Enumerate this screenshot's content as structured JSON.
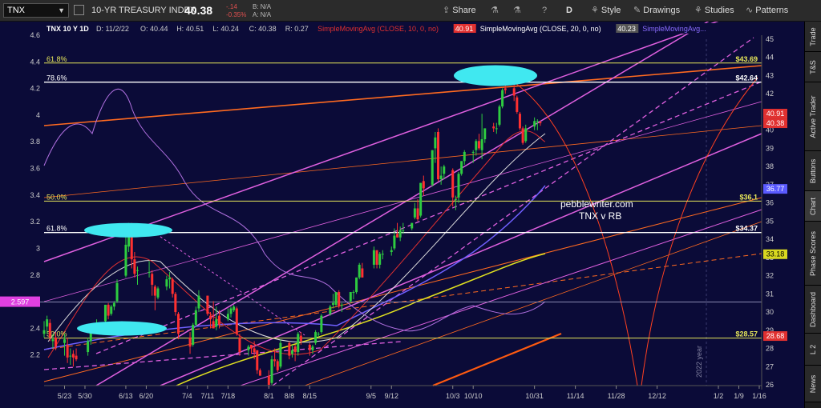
{
  "toolbar": {
    "symbol": "TNX",
    "description": "10-YR TREASURY INDEX",
    "last": "40.38",
    "change": "-.14",
    "change_pct": "-0.35%",
    "bid": "B: N/A",
    "ask": "A: N/A",
    "share": "Share",
    "period": "D",
    "style": "Style",
    "drawings": "Drawings",
    "studies": "Studies",
    "patterns": "Patterns"
  },
  "right_tabs": [
    "Trade",
    "T&S",
    "Active Trader",
    "Buttons",
    "Chart",
    "Phase Scores",
    "Dashboard",
    "L 2",
    "News"
  ],
  "chart_data": {
    "type": "line",
    "title": "TNX 10 Y 1D",
    "ohlc_header": {
      "date": "D: 11/2/22",
      "open": "O: 40.44",
      "high": "H: 40.51",
      "low": "L: 40.24",
      "close": "C: 40.38",
      "range": "R: 0.27"
    },
    "study_legend": [
      {
        "label": "SimpleMovingAvg (CLOSE, 10, 0, no)",
        "value": "40.91",
        "color": "#e03030"
      },
      {
        "label": "SimpleMovingAvg (CLOSE, 20, 0, no)",
        "value": "40.23",
        "color": "#ffffff"
      },
      {
        "label": "SimpleMovingAvg...",
        "value": "",
        "color": "#8a6cff"
      }
    ],
    "x_ticks": [
      "5/23",
      "5/30",
      "6/13",
      "6/20",
      "7/4",
      "7/11",
      "7/18",
      "8/1",
      "8/8",
      "8/15",
      "9/5",
      "9/12",
      "10/3",
      "10/10",
      "10/31",
      "11/14",
      "11/28",
      "12/12",
      "1/2",
      "1/9",
      "1/16"
    ],
    "x_tick_dates": [
      "2022-05-23",
      "2022-05-30",
      "2022-06-13",
      "2022-06-20",
      "2022-07-04",
      "2022-07-11",
      "2022-07-18",
      "2022-08-01",
      "2022-08-08",
      "2022-08-15",
      "2022-09-05",
      "2022-09-12",
      "2022-10-03",
      "2022-10-10",
      "2022-10-31",
      "2022-11-14",
      "2022-11-28",
      "2022-12-12",
      "2023-01-02",
      "2023-01-09",
      "2023-01-16"
    ],
    "xlim": [
      "2022-05-16",
      "2023-01-16"
    ],
    "year_marker": {
      "label": "2022 year",
      "date": "2023-01-02"
    },
    "left_axis": {
      "ylim": [
        2.0,
        4.6
      ],
      "ticks": [
        2.2,
        2.4,
        2.6,
        2.8,
        3,
        3.2,
        3.4,
        3.6,
        3.8,
        4,
        4.2,
        4.4,
        4.6
      ],
      "marker": {
        "label": "2.597",
        "value": 2.597,
        "color": "#e040e0"
      }
    },
    "right_axis": {
      "ylim": [
        26,
        45
      ],
      "ticks": [
        26,
        27,
        28,
        29,
        30,
        31,
        32,
        33,
        34,
        35,
        36,
        37,
        38,
        39,
        40,
        41,
        42,
        43,
        44,
        45
      ]
    },
    "fib_levels": [
      {
        "label": "61.8%",
        "value": 43.69,
        "price": "$43.69",
        "color": "#e8e85a"
      },
      {
        "label": "78.6%",
        "value": 42.64,
        "price": "$42.64",
        "color": "#ffffff"
      },
      {
        "label": "50.0%",
        "value": 36.1,
        "price": "$36.1",
        "color": "#e8e85a"
      },
      {
        "label": "61.8%",
        "value": 34.37,
        "price": "$34.37",
        "color": "#ffffff"
      },
      {
        "label": "50.0%",
        "value": 28.57,
        "price": "$28.57",
        "color": "#e8e85a"
      }
    ],
    "price_badges": [
      {
        "value": 40.91,
        "label": "40.91",
        "color": "#e03030"
      },
      {
        "value": 40.38,
        "label": "40.38",
        "color": "#e03030"
      },
      {
        "value": 36.77,
        "label": "36.77",
        "color": "#5a5aff"
      },
      {
        "value": 33.18,
        "label": "33.18",
        "color": "#d8d820"
      },
      {
        "value": 28.68,
        "label": "28.68",
        "color": "#e03030"
      }
    ],
    "annotations": [
      "pebblewriter.com",
      "TNX v RB"
    ],
    "candles": [
      [
        "2022-05-16",
        28.8,
        29.5,
        28.6,
        29.0
      ],
      [
        "2022-05-17",
        29.2,
        29.8,
        28.8,
        29.6
      ],
      [
        "2022-05-18",
        29.4,
        29.6,
        28.4,
        28.6
      ],
      [
        "2022-05-19",
        28.4,
        28.8,
        28.0,
        28.5
      ],
      [
        "2022-05-20",
        28.6,
        28.9,
        27.9,
        28.1
      ],
      [
        "2022-05-23",
        28.3,
        28.8,
        27.6,
        28.5
      ],
      [
        "2022-05-24",
        28.2,
        28.6,
        27.2,
        27.5
      ],
      [
        "2022-05-25",
        27.6,
        28.0,
        27.1,
        27.6
      ],
      [
        "2022-05-26",
        27.7,
        27.9,
        27.0,
        27.5
      ],
      [
        "2022-05-27",
        27.6,
        28.0,
        27.3,
        27.4
      ],
      [
        "2022-05-31",
        27.8,
        28.6,
        27.6,
        28.4
      ],
      [
        "2022-06-01",
        28.4,
        29.2,
        28.2,
        29.1
      ],
      [
        "2022-06-02",
        29.1,
        29.2,
        28.8,
        29.0
      ],
      [
        "2022-06-03",
        29.0,
        29.6,
        28.9,
        29.4
      ],
      [
        "2022-06-06",
        29.5,
        30.4,
        29.4,
        30.4
      ],
      [
        "2022-06-07",
        30.4,
        30.5,
        29.6,
        29.8
      ],
      [
        "2022-06-08",
        29.9,
        30.4,
        29.8,
        30.3
      ],
      [
        "2022-06-09",
        30.3,
        30.6,
        30.1,
        30.5
      ],
      [
        "2022-06-10",
        30.6,
        31.8,
        30.5,
        31.6
      ],
      [
        "2022-06-13",
        32.0,
        34.5,
        31.9,
        33.7
      ],
      [
        "2022-06-14",
        33.6,
        34.9,
        33.3,
        34.3
      ],
      [
        "2022-06-15",
        34.3,
        34.9,
        32.4,
        32.9
      ],
      [
        "2022-06-16",
        32.9,
        33.3,
        31.9,
        32.1
      ],
      [
        "2022-06-17",
        32.3,
        32.5,
        31.5,
        32.3
      ],
      [
        "2022-06-21",
        32.2,
        32.8,
        31.9,
        32.2
      ],
      [
        "2022-06-22",
        32.1,
        32.3,
        30.9,
        31.5
      ],
      [
        "2022-06-23",
        31.4,
        31.5,
        30.1,
        30.9
      ],
      [
        "2022-06-24",
        30.8,
        31.4,
        30.7,
        31.3
      ],
      [
        "2022-06-27",
        31.4,
        32.0,
        31.2,
        31.8
      ],
      [
        "2022-06-28",
        31.8,
        32.2,
        31.3,
        31.9
      ],
      [
        "2022-06-29",
        31.8,
        31.9,
        30.8,
        31.0
      ],
      [
        "2022-06-30",
        31.0,
        31.1,
        29.8,
        30.0
      ],
      [
        "2022-07-01",
        29.9,
        30.0,
        28.5,
        28.8
      ],
      [
        "2022-07-05",
        28.6,
        28.9,
        27.7,
        28.1
      ],
      [
        "2022-07-06",
        28.2,
        29.4,
        28.1,
        29.3
      ],
      [
        "2022-07-07",
        29.3,
        30.3,
        29.2,
        30.1
      ],
      [
        "2022-07-08",
        30.2,
        31.2,
        30.0,
        30.9
      ],
      [
        "2022-07-11",
        30.9,
        30.9,
        29.8,
        29.9
      ],
      [
        "2022-07-12",
        29.8,
        30.0,
        29.1,
        29.6
      ],
      [
        "2022-07-13",
        29.5,
        30.6,
        29.1,
        29.1
      ],
      [
        "2022-07-14",
        29.2,
        30.3,
        29.0,
        29.6
      ],
      [
        "2022-07-15",
        29.8,
        30.1,
        29.1,
        29.3
      ],
      [
        "2022-07-18",
        29.6,
        30.2,
        29.5,
        29.9
      ],
      [
        "2022-07-19",
        29.9,
        30.3,
        29.7,
        30.2
      ],
      [
        "2022-07-20",
        30.1,
        30.4,
        30.0,
        30.3
      ],
      [
        "2022-07-21",
        30.2,
        30.3,
        28.7,
        28.8
      ],
      [
        "2022-07-22",
        28.6,
        28.8,
        27.6,
        27.8
      ],
      [
        "2022-07-25",
        27.9,
        28.2,
        27.6,
        28.1
      ],
      [
        "2022-07-26",
        28.2,
        28.2,
        27.7,
        28.0
      ],
      [
        "2022-07-27",
        28.0,
        28.4,
        27.4,
        27.8
      ],
      [
        "2022-07-28",
        27.9,
        27.9,
        26.6,
        26.8
      ],
      [
        "2022-07-29",
        26.8,
        26.9,
        26.5,
        26.5
      ],
      [
        "2022-08-01",
        26.5,
        26.8,
        25.8,
        26.0
      ],
      [
        "2022-08-02",
        26.1,
        27.6,
        26.0,
        27.4
      ],
      [
        "2022-08-03",
        27.4,
        28.0,
        27.0,
        27.3
      ],
      [
        "2022-08-04",
        27.3,
        27.4,
        26.7,
        26.8
      ],
      [
        "2022-08-05",
        27.0,
        28.5,
        26.9,
        28.3
      ],
      [
        "2022-08-08",
        28.3,
        28.4,
        27.4,
        27.6
      ],
      [
        "2022-08-09",
        27.7,
        28.2,
        27.5,
        27.9
      ],
      [
        "2022-08-10",
        28.1,
        28.2,
        27.3,
        27.8
      ],
      [
        "2022-08-11",
        27.8,
        28.9,
        27.6,
        28.8
      ],
      [
        "2022-08-12",
        28.7,
        28.9,
        28.2,
        28.4
      ],
      [
        "2022-08-15",
        28.2,
        28.3,
        27.6,
        27.9
      ],
      [
        "2022-08-16",
        27.9,
        28.2,
        27.7,
        28.1
      ],
      [
        "2022-08-17",
        28.3,
        29.0,
        28.2,
        28.9
      ],
      [
        "2022-08-18",
        28.8,
        28.9,
        28.6,
        28.8
      ],
      [
        "2022-08-19",
        28.9,
        29.9,
        28.8,
        29.8
      ],
      [
        "2022-08-22",
        29.9,
        30.4,
        29.8,
        30.3
      ],
      [
        "2022-08-23",
        30.4,
        31.0,
        30.2,
        30.5
      ],
      [
        "2022-08-24",
        30.4,
        31.1,
        30.3,
        31.1
      ],
      [
        "2022-08-25",
        31.1,
        31.2,
        30.2,
        30.3
      ],
      [
        "2022-08-26",
        30.4,
        30.5,
        30.0,
        30.4
      ],
      [
        "2022-08-29",
        30.6,
        31.1,
        30.5,
        31.1
      ],
      [
        "2022-08-30",
        31.1,
        31.2,
        30.7,
        31.1
      ],
      [
        "2022-08-31",
        31.1,
        31.9,
        31.0,
        31.9
      ],
      [
        "2022-09-01",
        31.9,
        32.7,
        31.8,
        32.6
      ],
      [
        "2022-09-02",
        32.4,
        32.7,
        31.9,
        31.9
      ],
      [
        "2022-09-06",
        32.6,
        33.6,
        32.4,
        33.4
      ],
      [
        "2022-09-07",
        33.4,
        33.4,
        32.4,
        32.6
      ],
      [
        "2022-09-08",
        32.6,
        33.3,
        32.4,
        33.2
      ],
      [
        "2022-09-09",
        33.2,
        33.4,
        32.9,
        33.2
      ],
      [
        "2022-09-12",
        33.3,
        33.6,
        33.1,
        33.4
      ],
      [
        "2022-09-13",
        33.5,
        34.6,
        33.4,
        34.2
      ],
      [
        "2022-09-14",
        34.3,
        34.9,
        34.1,
        34.1
      ],
      [
        "2022-09-15",
        34.1,
        34.7,
        33.9,
        34.5
      ],
      [
        "2022-09-16",
        34.5,
        34.9,
        34.3,
        34.5
      ],
      [
        "2022-09-19",
        34.6,
        34.9,
        34.5,
        34.9
      ],
      [
        "2022-09-20",
        35.2,
        36.0,
        35.1,
        35.7
      ],
      [
        "2022-09-21",
        35.7,
        36.2,
        35.0,
        35.1
      ],
      [
        "2022-09-22",
        35.3,
        37.1,
        35.2,
        37.1
      ],
      [
        "2022-09-23",
        37.2,
        37.5,
        36.4,
        36.8
      ],
      [
        "2022-09-26",
        37.0,
        38.9,
        36.9,
        38.9
      ],
      [
        "2022-09-27",
        39.0,
        39.9,
        38.2,
        39.6
      ],
      [
        "2022-09-28",
        39.9,
        40.1,
        37.2,
        37.3
      ],
      [
        "2022-09-29",
        37.3,
        38.0,
        37.0,
        37.5
      ],
      [
        "2022-09-30",
        37.6,
        38.1,
        37.3,
        38.0
      ],
      [
        "2022-10-03",
        37.8,
        37.9,
        35.8,
        36.3
      ],
      [
        "2022-10-04",
        36.2,
        36.4,
        35.6,
        36.2
      ],
      [
        "2022-10-05",
        36.3,
        37.7,
        36.0,
        37.6
      ],
      [
        "2022-10-06",
        37.6,
        38.3,
        37.5,
        38.3
      ],
      [
        "2022-10-07",
        38.3,
        38.9,
        38.1,
        38.8
      ],
      [
        "2022-10-10",
        38.8,
        38.9,
        38.2,
        38.8
      ],
      [
        "2022-10-11",
        38.9,
        39.5,
        38.6,
        39.4
      ],
      [
        "2022-10-12",
        39.4,
        39.8,
        38.9,
        39.0
      ],
      [
        "2022-10-13",
        38.9,
        40.9,
        38.4,
        39.5
      ],
      [
        "2022-10-14",
        39.5,
        40.1,
        39.3,
        40.1
      ],
      [
        "2022-10-17",
        40.2,
        40.4,
        39.9,
        40.1
      ],
      [
        "2022-10-18",
        40.1,
        40.4,
        39.8,
        40.1
      ],
      [
        "2022-10-19",
        40.3,
        41.4,
        40.2,
        41.3
      ],
      [
        "2022-10-20",
        41.3,
        42.3,
        41.2,
        42.2
      ],
      [
        "2022-10-21",
        42.3,
        43.3,
        42.0,
        42.2
      ],
      [
        "2022-10-24",
        42.3,
        42.5,
        41.6,
        41.9
      ],
      [
        "2022-10-25",
        41.8,
        41.9,
        40.9,
        41.0
      ],
      [
        "2022-10-26",
        40.9,
        41.0,
        40.0,
        40.1
      ],
      [
        "2022-10-27",
        40.1,
        40.2,
        39.2,
        39.3
      ],
      [
        "2022-10-28",
        39.4,
        40.3,
        39.3,
        40.1
      ],
      [
        "2022-10-31",
        40.2,
        40.7,
        40.0,
        40.5
      ],
      [
        "2022-11-01",
        40.5,
        40.6,
        40.0,
        40.5
      ],
      [
        "2022-11-02",
        40.44,
        40.51,
        40.24,
        40.38
      ]
    ]
  }
}
